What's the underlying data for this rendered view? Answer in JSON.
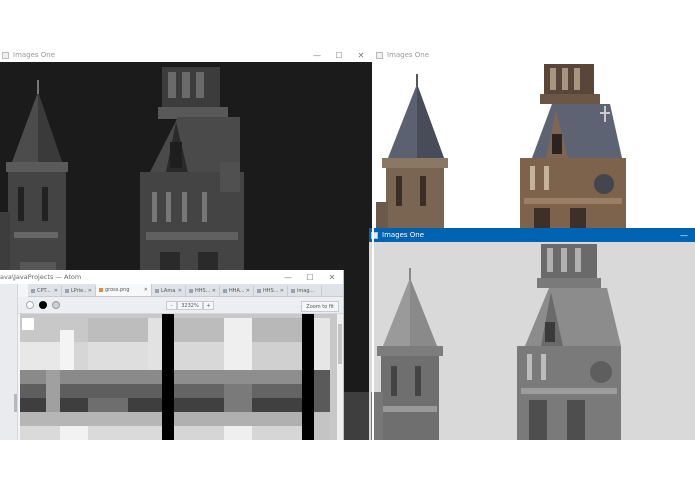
{
  "windows": {
    "dark": {
      "title": "Images One",
      "controls": [
        "—",
        "☐",
        "✕"
      ]
    },
    "color": {
      "title": "Images One"
    },
    "light": {
      "title": "Images One",
      "controls": [
        "—"
      ]
    },
    "atom": {
      "title": "ava\\JavaProjects — Atom",
      "controls": [
        "—",
        "☐",
        "✕"
      ],
      "tabs": [
        {
          "label": "CPT..."
        },
        {
          "label": "LPrie..."
        },
        {
          "label": "gross.png",
          "active": true
        },
        {
          "label": "LAma..."
        },
        {
          "label": "HHS..."
        },
        {
          "label": "HHA..."
        },
        {
          "label": "HHS..."
        },
        {
          "label": "imag..."
        }
      ],
      "tab_close": "✕",
      "zoom": {
        "minus": "-",
        "value": "3232%",
        "plus": "+"
      },
      "fit_label": "Zoom to fit",
      "swatch_colors": [
        "#ffffff",
        "#000000",
        "#d0d0d0"
      ]
    }
  },
  "colors": {
    "active_titlebar": "#0063b1",
    "dark_bg": "#1c1c1c",
    "light_bg": "#d8d8d8"
  },
  "icons": [
    "window-icon",
    "minimize-icon",
    "maximize-icon",
    "close-icon",
    "tab-file-icon",
    "image-file-icon"
  ]
}
